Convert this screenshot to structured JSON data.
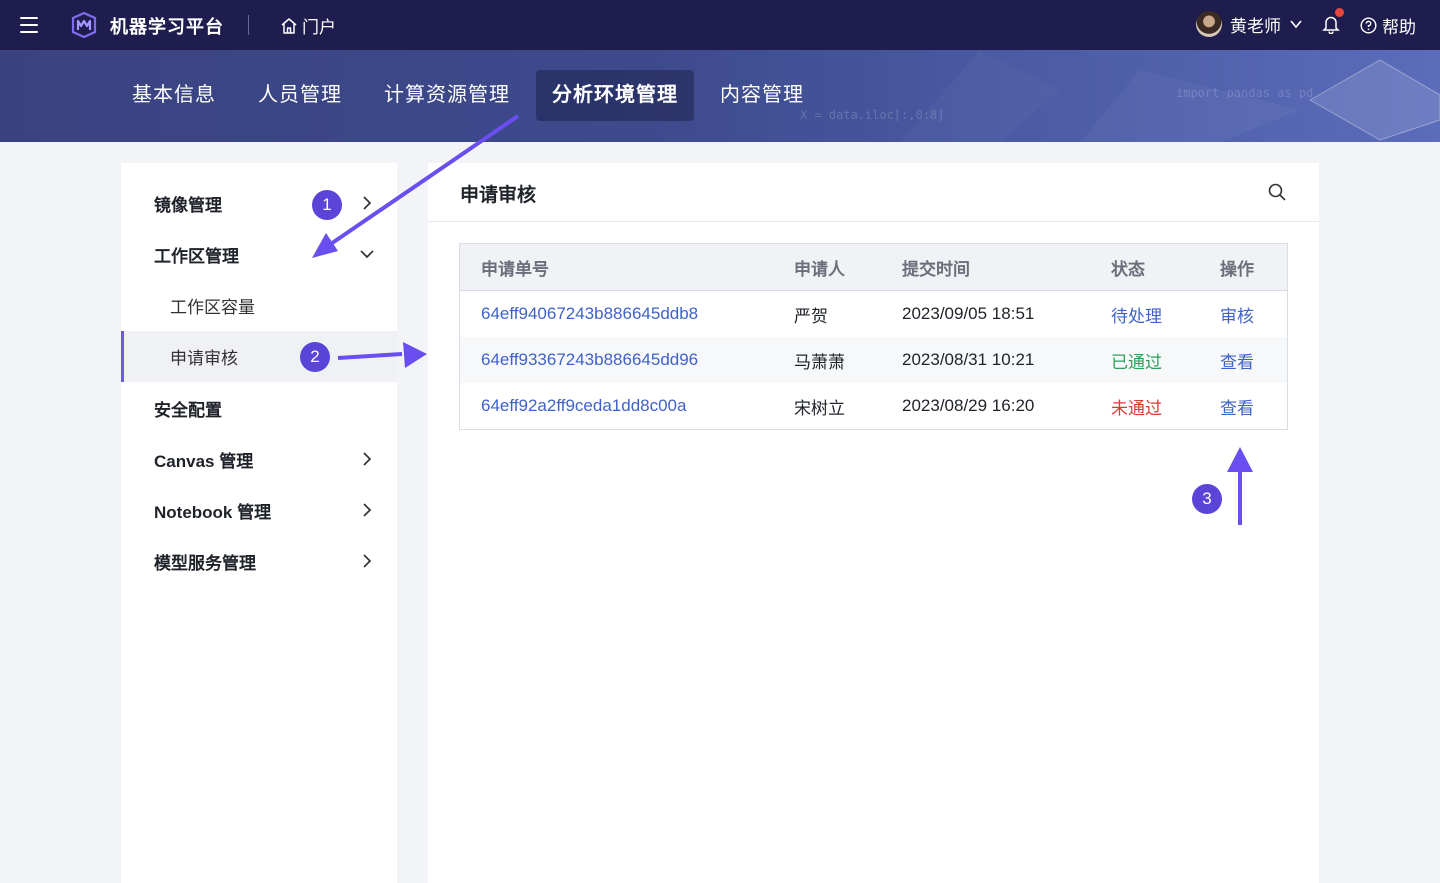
{
  "topbar": {
    "app_title": "机器学习平台",
    "portal_label": "门户",
    "user_name": "黄老师",
    "help_label": "帮助"
  },
  "banner": {
    "tabs": [
      {
        "label": "基本信息",
        "active": false
      },
      {
        "label": "人员管理",
        "active": false
      },
      {
        "label": "计算资源管理",
        "active": false
      },
      {
        "label": "分析环境管理",
        "active": true
      },
      {
        "label": "内容管理",
        "active": false
      }
    ],
    "code_snippets": [
      "import pandas as pd",
      "X = data.iloc[:,0:8]"
    ]
  },
  "sidebar": {
    "items": [
      {
        "label": "镜像管理",
        "chevron": "right"
      },
      {
        "label": "工作区管理",
        "chevron": "down"
      },
      {
        "label": "工作区容量",
        "chevron": ""
      },
      {
        "label": "申请审核",
        "chevron": ""
      },
      {
        "label": "安全配置",
        "chevron": ""
      },
      {
        "label": "Canvas 管理",
        "chevron": "right"
      },
      {
        "label": "Notebook 管理",
        "chevron": "right"
      },
      {
        "label": "模型服务管理",
        "chevron": "right"
      }
    ]
  },
  "panel": {
    "title": "申请审核",
    "columns": [
      "申请单号",
      "申请人",
      "提交时间",
      "状态",
      "操作"
    ],
    "rows": [
      {
        "id": "64eff94067243b886645ddb8",
        "applicant": "严贺",
        "time": "2023/09/05 18:51",
        "status": "待处理",
        "status_type": "pending",
        "action": "审核"
      },
      {
        "id": "64eff93367243b886645dd96",
        "applicant": "马萧萧",
        "time": "2023/08/31 10:21",
        "status": "已通过",
        "status_type": "pass",
        "action": "查看"
      },
      {
        "id": "64eff92a2ff9ceda1dd8c00a",
        "applicant": "宋树立",
        "time": "2023/08/29 16:20",
        "status": "未通过",
        "status_type": "fail",
        "action": "查看"
      }
    ]
  },
  "annotations": {
    "badges": [
      "1",
      "2",
      "3"
    ],
    "color": "#6b4ef0"
  },
  "colors": {
    "topbar": "#1f1d4e",
    "accent": "#5b44d8",
    "link": "#3f62c9",
    "pass": "#2e9e58",
    "fail": "#d93a32"
  }
}
